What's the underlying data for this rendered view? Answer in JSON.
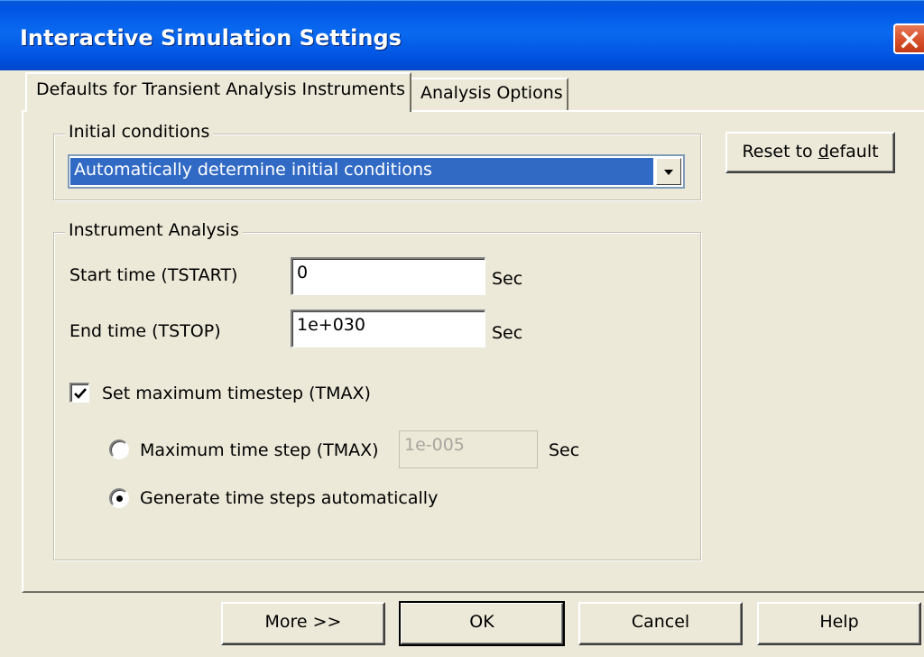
{
  "window": {
    "title": "Interactive Simulation Settings"
  },
  "tabs": [
    {
      "label": "Defaults for Transient Analysis Instruments",
      "active": true
    },
    {
      "label": "Analysis Options",
      "active": false
    }
  ],
  "initial_conditions": {
    "group_label": "Initial conditions",
    "selected": "Automatically determine initial conditions"
  },
  "reset_button": {
    "label_before": "Reset to ",
    "label_mnemonic": "d",
    "label_after": "efault"
  },
  "instrument_analysis": {
    "group_label": "Instrument Analysis",
    "start_time": {
      "label": "Start time (TSTART)",
      "value": "0",
      "unit": "Sec"
    },
    "end_time": {
      "label": "End time (TSTOP)",
      "value": "1e+030",
      "unit": "Sec"
    },
    "set_max_timestep": {
      "label": "Set maximum timestep (TMAX)",
      "checked": true
    },
    "max_time_step": {
      "label": "Maximum time step (TMAX)",
      "value": "1e-005",
      "unit": "Sec",
      "selected": false
    },
    "auto_steps": {
      "label": "Generate time steps automatically",
      "selected": true
    }
  },
  "footer_buttons": {
    "more": "More >>",
    "ok": "OK",
    "cancel": "Cancel",
    "help": "Help"
  },
  "colors": {
    "titlebar": "#0054e3",
    "selection": "#316ac5",
    "face": "#ece9d8",
    "close": "#d9532e"
  }
}
